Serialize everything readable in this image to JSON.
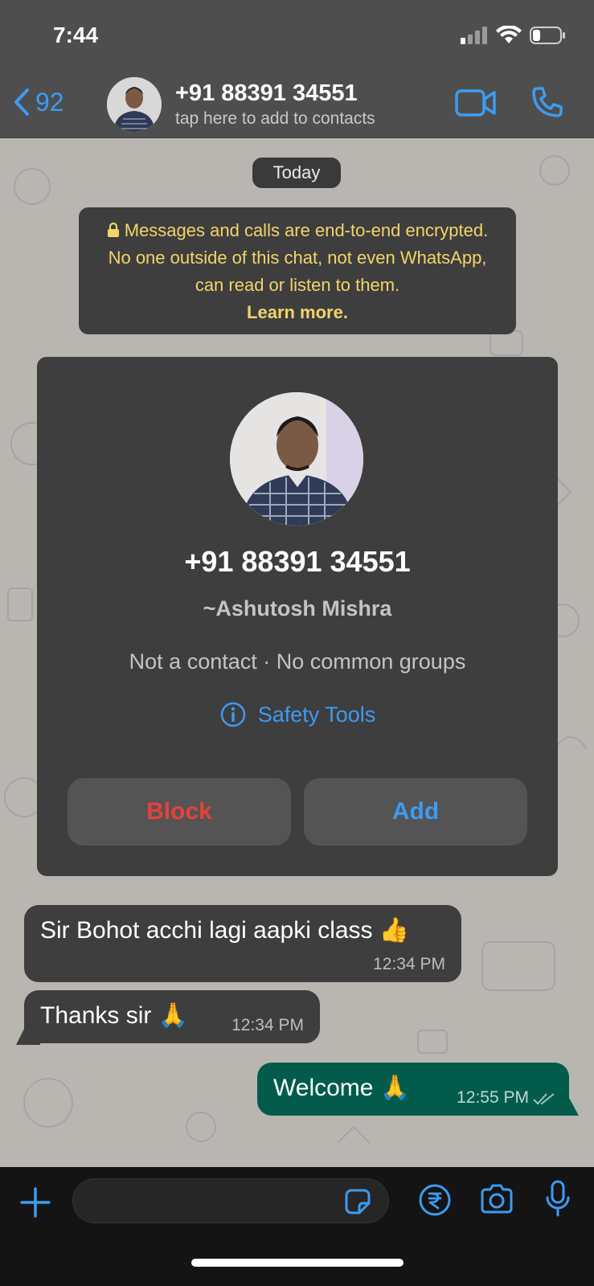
{
  "status": {
    "time": "7:44"
  },
  "header": {
    "back_count": "92",
    "title": "+91 88391 34551",
    "subtitle": "tap here to add to contacts"
  },
  "chat": {
    "date_chip": "Today",
    "encryption": {
      "text": "Messages and calls are end-to-end encrypted. No one outside of this chat, not even WhatsApp, can read or listen to them.",
      "link": "Learn more."
    },
    "contact_card": {
      "phone": "+91 88391 34551",
      "alias": "~Ashutosh Mishra",
      "meta": "Not a contact · No common groups",
      "safety": "Safety Tools",
      "block_label": "Block",
      "add_label": "Add"
    },
    "messages": [
      {
        "direction": "in",
        "text": "Sir Bohot acchi lagi aapki class 👍",
        "time": "12:34 PM"
      },
      {
        "direction": "in",
        "text": "Thanks sir 🙏",
        "time": "12:34 PM"
      },
      {
        "direction": "out",
        "text": "Welcome 🙏",
        "time": "12:55 PM"
      }
    ]
  },
  "colors": {
    "accent": "#3d9bf2",
    "block": "#e8403b",
    "encryption_text": "#f3d46a",
    "outgoing_bubble": "#035c4b"
  }
}
